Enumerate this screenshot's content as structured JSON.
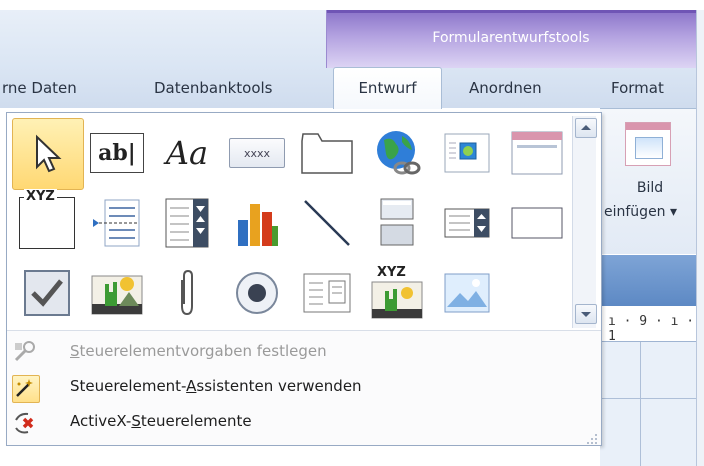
{
  "ribbon": {
    "context_title": "Formularentwurfstools",
    "tabs": [
      {
        "label": "rne Daten"
      },
      {
        "label": "Datenbanktools"
      },
      {
        "label": "Entwurf"
      },
      {
        "label": "Anordnen"
      },
      {
        "label": "Format"
      }
    ],
    "active_tab": "Entwurf",
    "insert_image_button": {
      "line1": "Bild",
      "line2": "einfügen ▾"
    }
  },
  "gallery": {
    "controls": [
      {
        "name": "select-pointer-icon",
        "selected": true
      },
      {
        "name": "textbox-icon",
        "text": "ab|"
      },
      {
        "name": "label-icon",
        "text": "Aa"
      },
      {
        "name": "button-icon",
        "text": "xxxx"
      },
      {
        "name": "tab-control-icon"
      },
      {
        "name": "hyperlink-icon"
      },
      {
        "name": "web-browser-icon"
      },
      {
        "name": "navigation-icon"
      },
      {
        "name": "option-group-icon",
        "text": "XYZ"
      },
      {
        "name": "page-break-icon"
      },
      {
        "name": "combo-box-icon"
      },
      {
        "name": "chart-icon"
      },
      {
        "name": "line-icon"
      },
      {
        "name": "toggle-button-icon"
      },
      {
        "name": "list-box-icon"
      },
      {
        "name": "rectangle-icon"
      },
      {
        "name": "checkbox-icon"
      },
      {
        "name": "unbound-object-frame-icon"
      },
      {
        "name": "attachment-icon"
      },
      {
        "name": "option-button-icon"
      },
      {
        "name": "subform-icon"
      },
      {
        "name": "bound-object-frame-icon",
        "text": "XYZ"
      },
      {
        "name": "image-icon"
      }
    ]
  },
  "menu": {
    "items": [
      {
        "label": "Steuerelementvorgaben festlegen",
        "enabled": false
      },
      {
        "label": "Steuerelement-Assistenten verwenden",
        "enabled": true,
        "active": true
      },
      {
        "label": "ActiveX-Steuerelemente",
        "enabled": true
      }
    ]
  },
  "ruler": {
    "text": "ı · 9 · ı · 1"
  },
  "colors": {
    "context_purple": "#8a73c9",
    "selection_gold": "#ffd873",
    "ribbon_blue": "#dbe6f4"
  }
}
